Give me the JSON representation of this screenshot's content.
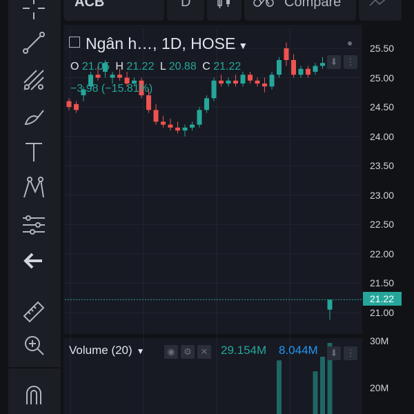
{
  "toolbar": {
    "symbol": "ACB",
    "interval": "D",
    "compare_label": "Compare"
  },
  "sidebar": {
    "items": [
      {
        "name": "crosshair-icon"
      },
      {
        "name": "trendline-icon"
      },
      {
        "name": "fib-icon"
      },
      {
        "name": "brush-icon"
      },
      {
        "name": "text-icon"
      },
      {
        "name": "pattern-icon"
      },
      {
        "name": "prediction-icon"
      },
      {
        "name": "back-arrow-icon"
      },
      {
        "name": "ruler-icon"
      },
      {
        "name": "zoom-icon"
      },
      {
        "name": "magnet-icon"
      }
    ]
  },
  "legend": {
    "title": "Ngân h…",
    "interval": ", 1D, HOSE",
    "o_label": "O",
    "o_value": "21.05",
    "h_label": "H",
    "h_value": "21.22",
    "l_label": "L",
    "l_value": "20.88",
    "c_label": "C",
    "c_value": "21.22",
    "change": "−3.98 (−15.81%)"
  },
  "price_scale": {
    "ticks": [
      "25.50",
      "25.00",
      "24.50",
      "24.00",
      "23.50",
      "23.00",
      "22.50",
      "22.00",
      "21.50",
      "21.00"
    ],
    "last_price": "21.22"
  },
  "volume": {
    "label": "Volume (20)",
    "value": "29.154M",
    "ma_value": "8.044M",
    "ticks": [
      "30M",
      "20M"
    ]
  },
  "colors": {
    "up": "#26a69a",
    "down": "#ef5350",
    "background": "#171a23",
    "ma": "#2196f3"
  },
  "chart_data": {
    "type": "candlestick",
    "ohlc": [
      [
        24.6,
        24.65,
        24.45,
        24.5
      ],
      [
        24.55,
        24.6,
        24.4,
        24.45
      ],
      [
        24.7,
        24.85,
        24.6,
        24.8
      ],
      [
        24.85,
        25.1,
        24.8,
        25.05
      ],
      [
        25.05,
        25.2,
        24.95,
        25.0
      ],
      [
        25.1,
        25.3,
        25.0,
        25.25
      ],
      [
        25.0,
        25.1,
        24.9,
        25.05
      ],
      [
        25.05,
        25.15,
        24.95,
        25.0
      ],
      [
        25.0,
        25.1,
        24.85,
        24.9
      ],
      [
        24.9,
        25.0,
        24.85,
        24.95
      ],
      [
        24.95,
        25.0,
        24.65,
        24.7
      ],
      [
        24.7,
        24.8,
        24.4,
        24.45
      ],
      [
        24.45,
        24.55,
        24.2,
        24.25
      ],
      [
        24.25,
        24.35,
        24.15,
        24.2
      ],
      [
        24.2,
        24.3,
        24.1,
        24.15
      ],
      [
        24.15,
        24.25,
        24.05,
        24.1
      ],
      [
        24.1,
        24.2,
        24.0,
        24.15
      ],
      [
        24.15,
        24.25,
        24.1,
        24.2
      ],
      [
        24.2,
        24.5,
        24.15,
        24.45
      ],
      [
        24.45,
        24.7,
        24.4,
        24.65
      ],
      [
        24.65,
        25.0,
        24.6,
        24.95
      ],
      [
        24.95,
        25.05,
        24.85,
        24.9
      ],
      [
        24.9,
        25.0,
        24.85,
        24.95
      ],
      [
        24.95,
        25.05,
        24.85,
        24.9
      ],
      [
        24.9,
        25.1,
        24.85,
        25.05
      ],
      [
        25.05,
        25.1,
        24.9,
        24.95
      ],
      [
        24.95,
        25.0,
        24.85,
        24.9
      ],
      [
        24.9,
        25.0,
        24.75,
        24.85
      ],
      [
        24.85,
        25.1,
        24.8,
        25.05
      ],
      [
        25.05,
        25.35,
        25.0,
        25.3
      ],
      [
        25.5,
        25.6,
        25.2,
        25.3
      ],
      [
        25.3,
        25.4,
        25.0,
        25.05
      ],
      [
        25.05,
        25.2,
        25.0,
        25.15
      ],
      [
        25.15,
        25.2,
        25.0,
        25.05
      ],
      [
        25.1,
        25.25,
        25.05,
        25.2
      ],
      [
        25.2,
        25.35,
        25.15,
        25.25
      ],
      [
        21.05,
        21.22,
        20.88,
        21.22
      ]
    ],
    "ylim": [
      20.8,
      25.7
    ],
    "volume": [
      0.0,
      0.0,
      0.0,
      0.0,
      0.0,
      0.0,
      0.0,
      0.0,
      0.0,
      0.0,
      0.0,
      0.0,
      0.0,
      0.0,
      0.0,
      0.0,
      0.0,
      0.0,
      0.0,
      0.0,
      0.0,
      0.0,
      0.0,
      0.0,
      0.0,
      0.0,
      0.0,
      0.0,
      0.0,
      22.0,
      0.0,
      0.0,
      0.0,
      0.0,
      17.5,
      23.5,
      29.154
    ],
    "volume_ylim": [
      0,
      30
    ]
  }
}
